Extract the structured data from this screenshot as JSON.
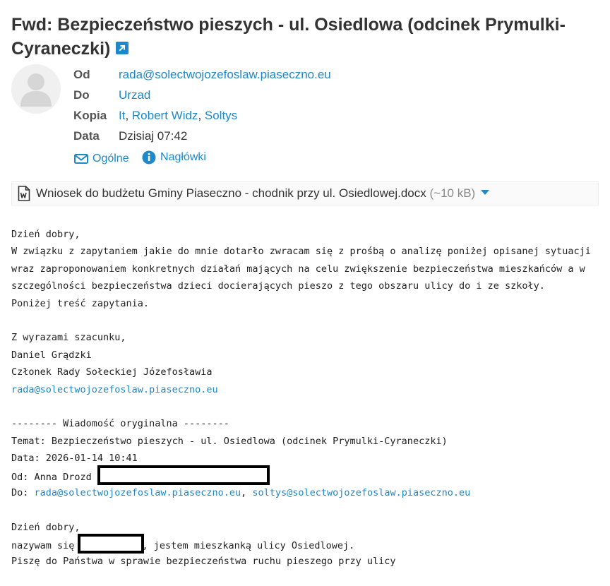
{
  "message": {
    "subject": "Fwd: Bezpieczeństwo pieszych - ul. Osiedlowa (odcinek Prymulki-Cyraneczki)",
    "open_external_icon": "external-link-icon",
    "avatar_icon": "user-silhouette-icon",
    "headers": {
      "from_label": "Od",
      "from": "rada@solectwojozefoslaw.piaseczno.eu",
      "to_label": "Do",
      "to": "Urzad",
      "cc_label": "Kopia",
      "cc": [
        "It",
        "Robert Widz",
        "Soltys"
      ],
      "cc_separator": ", ",
      "date_label": "Data",
      "date": "Dzisiaj 07:42"
    },
    "header_tabs": {
      "general": "Ogólne",
      "headers": "Nagłówki"
    },
    "attachment": {
      "name": "Wniosek do budżetu Gminy Piaseczno - chodnik przy ul. Osiedlowej.docx",
      "size": "(~10 kB)",
      "icon": "word-document-icon"
    },
    "body": {
      "greeting": "Dzień dobry,",
      "paragraph": "W związku z zapytaniem jakie do mnie dotarło zwracam się z prośbą o analizę poniżej opisanej sytuacji wraz zaproponowaniem konkretnych działań mających na celu zwiększenie bezpieczeństwa mieszkańców a w szczególności bezpieczeństwa dzieci docierających pieszo z tego obszaru ulicy do i ze szkoły.",
      "intro": "Poniżej treść zapytania.",
      "closing": "Z wyrazami szacunku,",
      "sig_name": "Daniel Grądzki",
      "sig_role": "Członek Rady Sołeckiej Józefosławia",
      "sig_email": "rada@solectwojozefoslaw.piaseczno.eu",
      "forward_header": "-------- Wiadomość oryginalna --------",
      "fwd_subject": "Temat: Bezpieczeństwo pieszych - ul. Osiedlowa (odcinek Prymulki-Cyraneczki)",
      "fwd_date": "Data: 2026-01-14 10:41",
      "fwd_from": "Od: Anna Drozd <",
      "fwd_to_prefix": "Do: ",
      "fwd_to_1": "rada@solectwojozefoslaw.piaseczno.eu",
      "fwd_to_sep": ", ",
      "fwd_to_2": "soltys@solectwojozefoslaw.piaseczno.eu",
      "orig_greeting": "Dzień dobry,",
      "orig_name_prefix": "nazywam się ",
      "orig_name_suffix": ", jestem mieszkanką ulicy Osiedlowej.",
      "orig_line3": "Piszę do Państwa w sprawie bezpieczeństwa ruchu pieszego przy ulicy"
    }
  }
}
